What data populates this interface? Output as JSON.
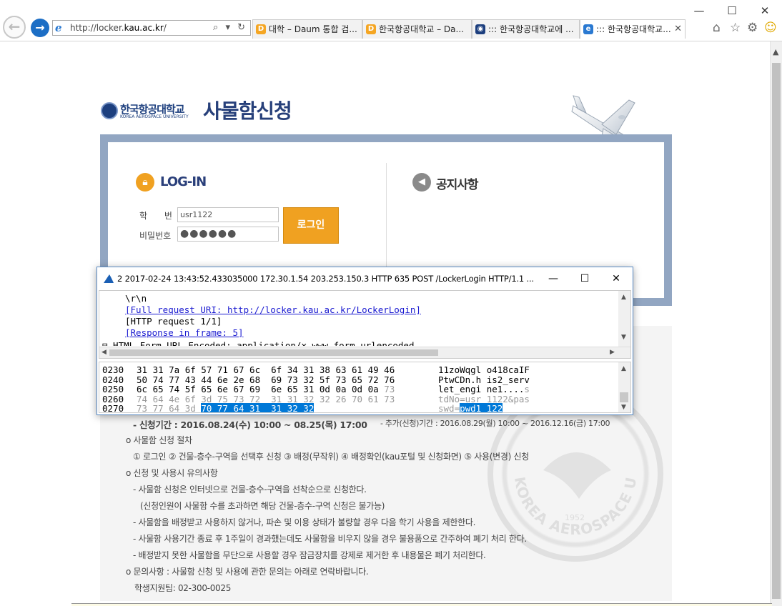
{
  "browser": {
    "url_prefix": "http://locker.",
    "url_domain": "kau.ac.kr",
    "url_suffix": "/",
    "search_tools": "⌕ ▾ ↻",
    "tabs": [
      {
        "title": "대학 – Daum 통합 검...",
        "icon": "daum-icon",
        "color": "#f5a623",
        "glyph": "D"
      },
      {
        "title": "한국항공대학교 – Da...",
        "icon": "daum-icon",
        "color": "#f5a623",
        "glyph": "D"
      },
      {
        "title": "::: 한국항공대학교에 ...",
        "icon": "kau-emblem-icon",
        "color": "#1d3f7e",
        "glyph": "◉"
      },
      {
        "title": "::: 한국항공대학교...",
        "icon": "ie-icon",
        "color": "#2a79d1",
        "glyph": "e"
      }
    ],
    "close_tab": "✕",
    "controls": {
      "minimize": "—",
      "maximize": "☐",
      "close": "✕"
    },
    "toolbar_icons": {
      "home": "⌂",
      "favorites": "☆",
      "settings": "⚙",
      "feedback": "☺"
    }
  },
  "page": {
    "logo_kr": "한국항공대학교",
    "logo_en": "KOREA AEROSPACE UNIVERSITY",
    "title": "사물함신청",
    "login": {
      "heading": "LOG-IN",
      "id_label": "학 번",
      "pw_label": "비밀번호",
      "id_value": "usr1122",
      "pw_mask": "●●●●●●",
      "button": "로그인"
    },
    "notice_heading": "공지사항",
    "info": [
      "- 신청기간 : 2016.08.24(수) 10:00 ~ 08.25(목) 17:00",
      "- 추가(신청)기간 : 2016.08.29(월) 10:00 ~ 2016.12.16(금) 17:00",
      "o 사물함 신청 절차",
      "① 로그인 ② 건물-층수-구역을 선택후 신청 ③ 배정(무작위) ④ 배정확인(kau포털 및 신청화면) ⑤ 사용(변경) 신청",
      "o 신청 및 사용시 유의사항",
      "- 사물함 신청은 인터넷으로 건물-층수-구역을 선착순으로 신청한다.",
      "(신청인원이 사물함 수를 초과하면 해당 건물-층수-구역 신청은 불가능)",
      "- 사물함을 배정받고 사용하지 않거나, 파손 및 이용 상태가 불량할 경우 다음 학기 사용을 제한한다.",
      "- 사물함 사용기간 종료 후 1주일이 경과했는데도 사물함을 비우지 않을 경우 불용품으로 간주하여 폐기 처리 한다.",
      "- 배정받지 못한 사물함을 무단으로 사용할 경우 잠금장치를 강제로 제거한 후 내용물은 폐기 처리한다.",
      "o 문의사항 : 사물함 신청 및 사용에 관한 문의는 아래로 연락바랍니다.",
      "학생지원팀: 02-300-0025"
    ],
    "seal": {
      "text": "KOREA AEROSPACE UNIVERSITY",
      "year": "1952"
    }
  },
  "wireshark": {
    "title": "2 2017-02-24 13:43:52.433035000 172.30.1.54 203.253.150.3 HTTP 635 POST /LockerLogin HTTP/1.1  ...",
    "controls": {
      "minimize": "—",
      "maximize": "☐",
      "close": "✕"
    },
    "tree": [
      {
        "text": "\\r\\n",
        "link": false
      },
      {
        "text": "[Full request URI: http://locker.kau.ac.kr/LockerLogin]",
        "link": true
      },
      {
        "text": "[HTTP request 1/1]",
        "link": false
      },
      {
        "text": "[Response in frame: 5]",
        "link": true
      }
    ],
    "tree_partial": "⊟ HTML Form URL Encoded: application/x-www-form-urlencoded",
    "hex_rows": [
      {
        "offset": "0230",
        "parts": [
          {
            "t": "31 31 7a 6f 57 71 67 6c  6f 34 31 38 63 61 49 46",
            "c": ""
          }
        ],
        "ascii": [
          {
            "t": "11zoWqgl o418caIF",
            "c": ""
          }
        ]
      },
      {
        "offset": "0240",
        "parts": [
          {
            "t": "50 74 77 43 44 6e 2e 68  69 73 32 5f 73 65 72 76",
            "c": ""
          }
        ],
        "ascii": [
          {
            "t": "PtwCDn.h is2_serv",
            "c": ""
          }
        ]
      },
      {
        "offset": "0250",
        "parts": [
          {
            "t": "6c 65 74 5f 65 6e 67 69  6e 65 31 0d 0a 0d 0a ",
            "c": ""
          },
          {
            "t": "73",
            "c": "dim"
          }
        ],
        "ascii": [
          {
            "t": "let_engi ne1....",
            "c": ""
          },
          {
            "t": "s",
            "c": "dim"
          }
        ]
      },
      {
        "offset": "0260",
        "parts": [
          {
            "t": "74 64 4e 6f 3d 75 73 72  31 31 32 32 26 70 61 73",
            "c": "dim"
          }
        ],
        "ascii": [
          {
            "t": "tdNo=usr 1122&pas",
            "c": "dim"
          }
        ]
      },
      {
        "offset": "0270",
        "parts": [
          {
            "t": "73 77 64 3d ",
            "c": "dim"
          },
          {
            "t": "70 77 64 31  31 32 32",
            "c": "sel"
          }
        ],
        "ascii": [
          {
            "t": "swd=",
            "c": "dim"
          },
          {
            "t": "pwd1 122",
            "c": "sel"
          }
        ]
      }
    ]
  }
}
